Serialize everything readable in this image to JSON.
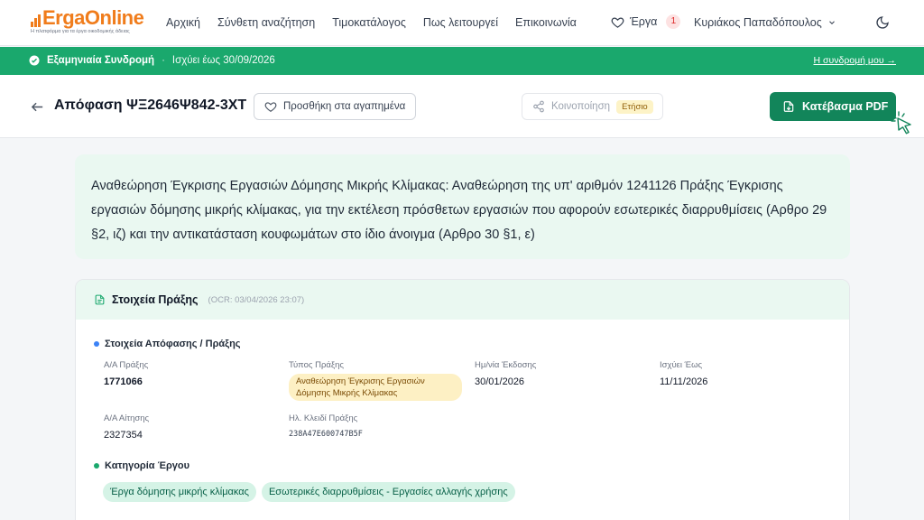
{
  "brand": {
    "name": "ErgaOnline",
    "tagline": "Η πλατφόρμα για τα έργα οικοδομικής άδειας",
    "color": "#f07c1b"
  },
  "nav": {
    "links": [
      "Αρχική",
      "Σύνθετη αναζήτηση",
      "Τιμοκατάλογος",
      "Πως λειτουργεί",
      "Επικοινωνία"
    ],
    "favorites_label": "Έργα",
    "favorites_count": "1",
    "user_name": "Κυριάκος Παπαδόπουλος"
  },
  "subscription": {
    "title": "Εξαμηνιαία Συνδρομή",
    "validity": "Ισχύει έως 30/09/2026",
    "link": "Η συνδρομή μου →",
    "color": "#1aa86d"
  },
  "header": {
    "doc_title": "Απόφαση ΨΞ2646Ψ842-3ΧΤ",
    "add_favorite": "Προσθήκη στα αγαπημένα",
    "share": "Κοινοποίηση",
    "share_tag": "Ετήσιο",
    "download_pdf": "Κατέβασμα PDF"
  },
  "summary": {
    "text": "Αναθεώρηση Έγκρισης Εργασιών Δόμησης Μικρής Κλίμακας: Αναθεώρηση της υπ' αριθμόν 1241126 Πράξης Έγκρισης εργασιών δόμησης μικρής κλίμακας, για την εκτέλεση πρόσθετων εργασιών που αφορούν εσωτερικές διαρρυθμίσεις (Αρθρο 29 §2, ιζ) και την αντικατάσταση κουφωμάτων στο ίδιο άνοιγμα (Αρθρο 30 §1, ε)"
  },
  "details": {
    "title": "Στοιχεία Πράξης",
    "ocr": "(OCR: 03/04/2026 23:07)",
    "section_decision": "Στοιχεία Απόφασης / Πράξης",
    "fields": {
      "aa_praxis_label": "Α/Α Πράξης",
      "aa_praxis": "1771066",
      "type_label": "Τύπος Πράξης",
      "type": "Αναθεώρηση Έγκρισης Εργασιών Δόμησης Μικρής Κλίμακας",
      "issue_date_label": "Ημ/νία Έκδοσης",
      "issue_date": "30/01/2026",
      "valid_until_label": "Ισχύει Έως",
      "valid_until": "11/11/2026",
      "aa_request_label": "Α/Α Αίτησης",
      "aa_request": "2327354",
      "el_key_label": "Ηλ. Κλειδί Πράξης",
      "el_key": "238A47E600747B5F"
    },
    "section_category": "Κατηγορία Έργου",
    "categories": [
      "Έργα δόμησης μικρής κλίμακας",
      "Εσωτερικές διαρρυθμίσεις - Εργασίες αλλαγής χρήσης"
    ]
  }
}
